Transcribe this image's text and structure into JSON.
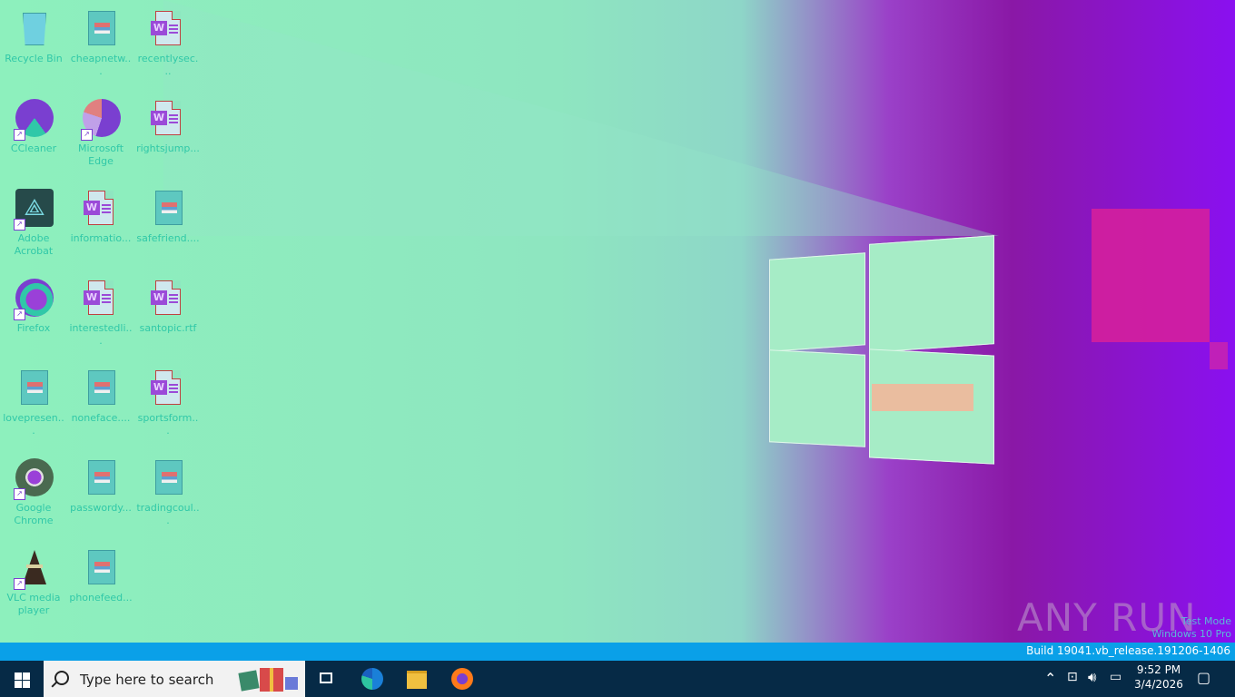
{
  "desktop_icons": [
    {
      "label": "Recycle Bin"
    },
    {
      "label": "cheapnetw..."
    },
    {
      "label": "recentlysec..."
    },
    {
      "label": "CCleaner"
    },
    {
      "label": "Microsoft Edge"
    },
    {
      "label": "rightsjump..."
    },
    {
      "label": "Adobe Acrobat"
    },
    {
      "label": "informatio..."
    },
    {
      "label": "safefriend...."
    },
    {
      "label": "Firefox"
    },
    {
      "label": "interestedli..."
    },
    {
      "label": "santopic.rtf"
    },
    {
      "label": "lovepresen..."
    },
    {
      "label": "noneface...."
    },
    {
      "label": "sportsform..."
    },
    {
      "label": "Google Chrome"
    },
    {
      "label": "passwordy..."
    },
    {
      "label": "tradingcoul..."
    },
    {
      "label": "VLC media player"
    },
    {
      "label": "phonefeed..."
    }
  ],
  "watermark": {
    "brand": "ANY RUN",
    "test_mode": "Test Mode",
    "windows_version": "Windows 10 Pro"
  },
  "build_string": "Build 19041.vb_release.191206-1406",
  "taskbar": {
    "search_placeholder": "Type here to search",
    "clock_time": "9:52 PM",
    "clock_date": "3/4/2026"
  }
}
